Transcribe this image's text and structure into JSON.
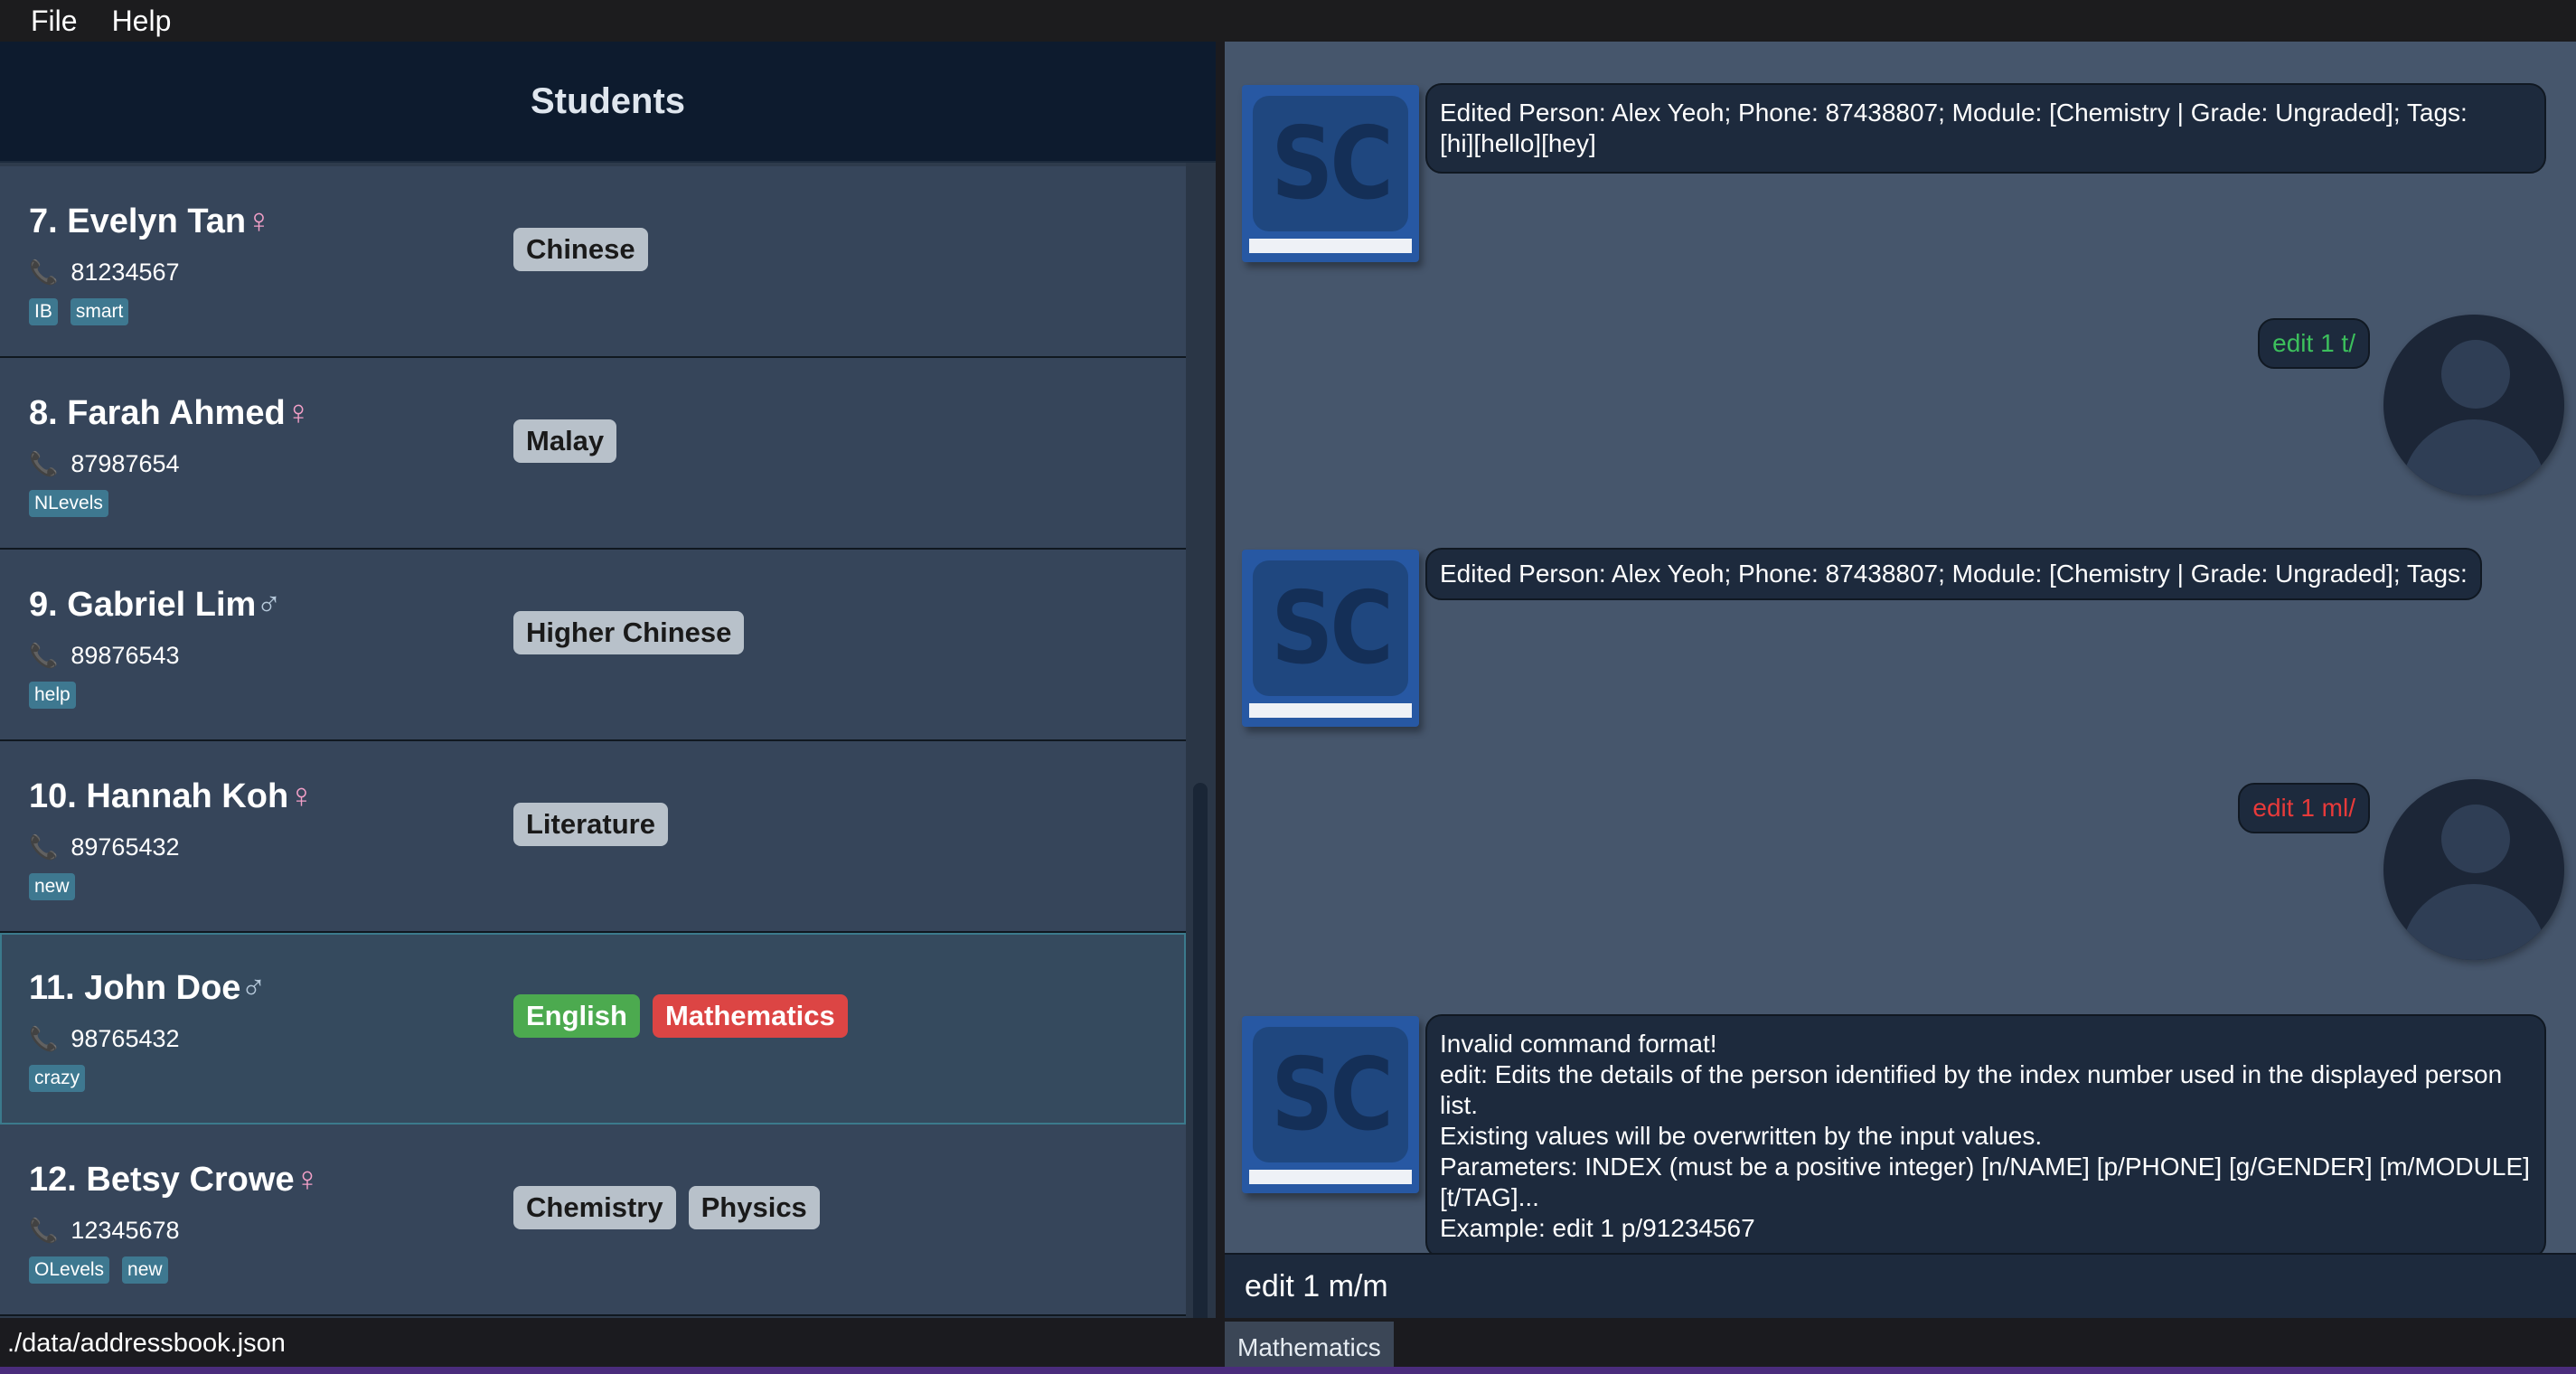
{
  "menu": [
    "File",
    "Help"
  ],
  "left_panel": {
    "title": "Students",
    "students": [
      {
        "index": "7.",
        "name": "Evelyn Tan",
        "gender_symbol": "♀",
        "gender": "female",
        "phone": "81234567",
        "tags": [
          "IB",
          "smart"
        ],
        "modules": [
          {
            "label": "Chinese",
            "style": "grey"
          }
        ]
      },
      {
        "index": "8.",
        "name": "Farah Ahmed",
        "gender_symbol": "♀",
        "gender": "female",
        "phone": "87987654",
        "tags": [
          "NLevels"
        ],
        "modules": [
          {
            "label": "Malay",
            "style": "grey"
          }
        ]
      },
      {
        "index": "9.",
        "name": "Gabriel Lim",
        "gender_symbol": "♂",
        "gender": "male",
        "phone": "89876543",
        "tags": [
          "help"
        ],
        "modules": [
          {
            "label": "Higher Chinese",
            "style": "grey"
          }
        ]
      },
      {
        "index": "10.",
        "name": "Hannah Koh",
        "gender_symbol": "♀",
        "gender": "female",
        "phone": "89765432",
        "tags": [
          "new"
        ],
        "modules": [
          {
            "label": "Literature",
            "style": "grey"
          }
        ]
      },
      {
        "index": "11.",
        "name": "John Doe",
        "gender_symbol": "♂",
        "gender": "male",
        "phone": "98765432",
        "tags": [
          "crazy"
        ],
        "modules": [
          {
            "label": "English",
            "style": "green"
          },
          {
            "label": "Mathematics",
            "style": "red"
          }
        ],
        "selected": true
      },
      {
        "index": "12.",
        "name": "Betsy Crowe",
        "gender_symbol": "♀",
        "gender": "female",
        "phone": "12345678",
        "tags": [
          "OLevels",
          "new"
        ],
        "modules": [
          {
            "label": "Chemistry",
            "style": "grey"
          },
          {
            "label": "Physics",
            "style": "grey"
          }
        ]
      }
    ]
  },
  "chat": {
    "logo_text": "SC",
    "messages": [
      {
        "from": "app",
        "lines": [
          "Edited Person: Alex Yeoh; Phone: 87438807; Module: [Chemistry | Grade: Ungraded]; Tags:",
          "[hi][hello][hey]"
        ]
      },
      {
        "from": "user",
        "text": "edit 1 t/",
        "status": "ok"
      },
      {
        "from": "app",
        "lines": [
          "Edited Person: Alex Yeoh; Phone: 87438807; Module: [Chemistry | Grade: Ungraded]; Tags:"
        ]
      },
      {
        "from": "user",
        "text": "edit 1 ml/",
        "status": "error"
      },
      {
        "from": "app",
        "lines": [
          "Invalid command format!",
          "edit: Edits the details of the person identified by the index number used in the displayed person list.",
          "Existing values will be overwritten by the input values.",
          "Parameters: INDEX (must be a positive integer) [n/NAME] [p/PHONE] [g/GENDER] [m/MODULE]",
          "[t/TAG]...",
          "Example: edit 1 p/91234567"
        ]
      }
    ]
  },
  "command_input": {
    "value": "edit 1 m/m"
  },
  "status_bar": {
    "path": "./data/addressbook.json"
  },
  "autocomplete": {
    "suggestion": "Mathematics"
  },
  "colors": {
    "ok_command": "#3cbf5c",
    "error_command": "#e83a3a",
    "module_green": "#4caa4f",
    "module_red": "#dc4544",
    "tag": "#3e7890"
  },
  "icons": {
    "phone": "phone-icon",
    "user_avatar": "user-avatar-icon",
    "app_logo": "app-logo-icon"
  }
}
